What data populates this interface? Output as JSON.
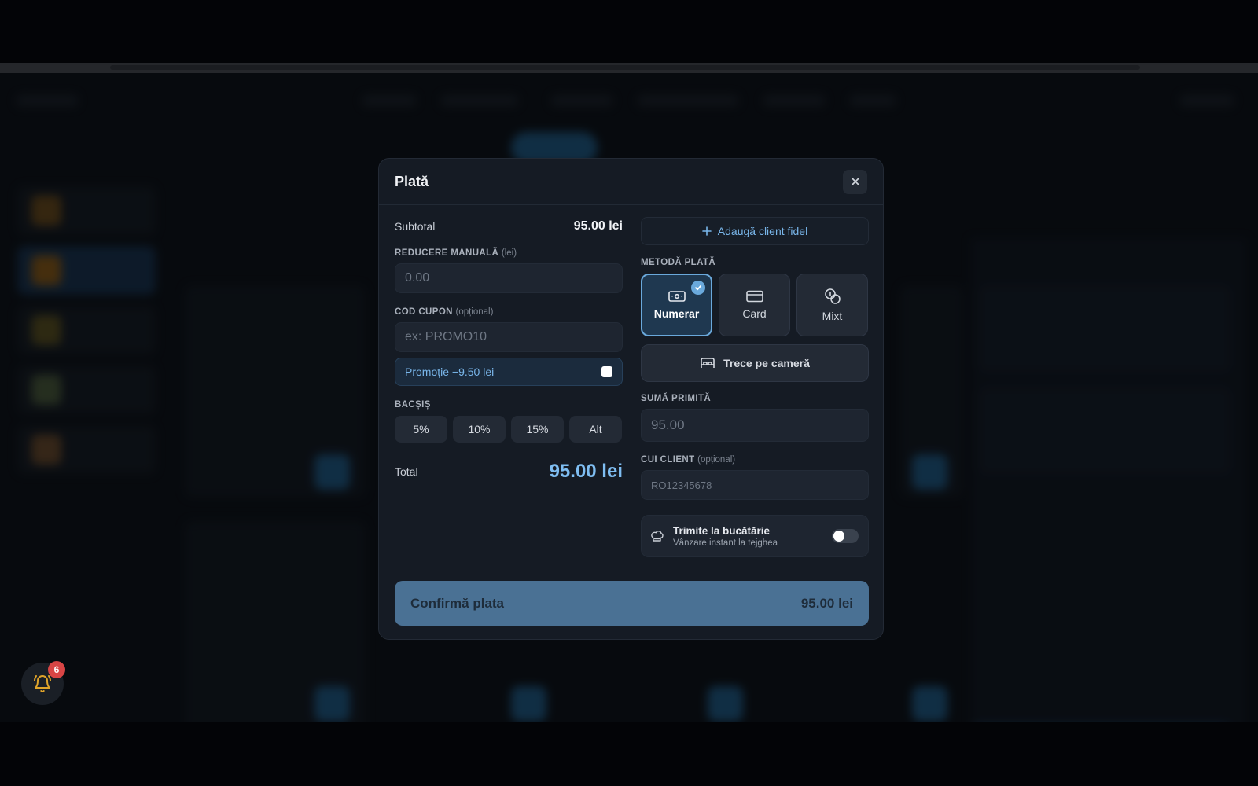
{
  "modal": {
    "title": "Plată",
    "close_icon": "close-icon"
  },
  "summary": {
    "subtotal_label": "Subtotal",
    "subtotal_value": "95.00 lei",
    "total_label": "Total",
    "total_value": "95.00 lei"
  },
  "discount": {
    "label": "REDUCERE MANUALĂ",
    "unit": "(lei)",
    "placeholder": "0.00"
  },
  "coupon": {
    "label": "COD CUPON",
    "optional": "(opțional)",
    "placeholder": "ex: PROMO10",
    "promo_text": "Promoție −9.50 lei",
    "promo_checked": false
  },
  "tip": {
    "label": "BACȘIȘ",
    "options": [
      "5%",
      "10%",
      "15%",
      "Alt"
    ]
  },
  "loyalty": {
    "label": "Adaugă client fidel"
  },
  "payment_method": {
    "label": "METODĂ PLATĂ",
    "options": [
      {
        "label": "Numerar",
        "icon": "cash-icon",
        "selected": true
      },
      {
        "label": "Card",
        "icon": "card-icon",
        "selected": false
      },
      {
        "label": "Mixt",
        "icon": "coins-icon",
        "selected": false
      }
    ],
    "room_label": "Trece pe cameră"
  },
  "received": {
    "label": "SUMĂ PRIMITĂ",
    "placeholder": "95.00"
  },
  "cui": {
    "label": "CUI CLIENT",
    "optional": "(opțional)",
    "placeholder": "RO12345678"
  },
  "kitchen": {
    "title": "Trimite la bucătărie",
    "subtitle": "Vânzare instant la tejghea",
    "enabled": false
  },
  "confirm": {
    "label": "Confirmă plata",
    "amount": "95.00 lei"
  },
  "notifications": {
    "count": "6"
  },
  "colors": {
    "accent": "#6aa9dc",
    "confirm_bg": "#4a7194",
    "badge": "#d84545"
  }
}
